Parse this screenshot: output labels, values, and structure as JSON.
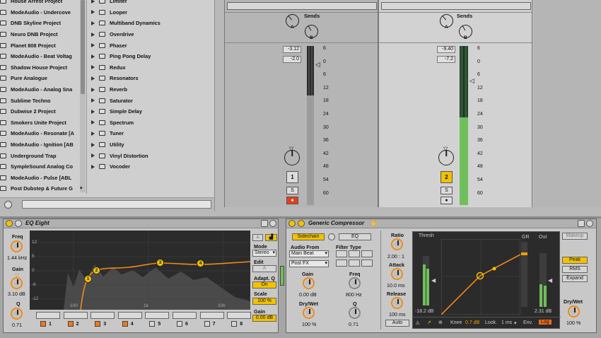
{
  "browser": {
    "left_items": [
      "House Arrest Project",
      "ModeAudio - Undercove",
      "DNB Skyline Project",
      "Neuro DNB Project",
      "Planet 808 Project",
      "ModeAudio - Beat Voltag",
      "Shadow House Project",
      "Pure Analogue",
      "ModeAudio - Analog Sna",
      "Sublime Techno",
      "Dubwise 2 Project",
      "Smokers Unite Project",
      "ModeAudio - Resonate [A",
      "ModeAudio - Ignition [AB",
      "Underground Trap",
      "SympleSound Analog Co",
      "ModeAudio - Pulse [ABL",
      "Post Dubstep & Future G"
    ],
    "right_items": [
      "Limiter",
      "Looper",
      "Multiband Dynamics",
      "Overdrive",
      "Phaser",
      "Ping Pong Delay",
      "Redux",
      "Resonators",
      "Reverb",
      "Saturator",
      "Simple Delay",
      "Spectrum",
      "Tuner",
      "Utility",
      "Vinyl Distortion",
      "Vocoder"
    ]
  },
  "mixer": {
    "strips": [
      {
        "sends_label": "Sends",
        "send_a": "A",
        "send_b": "B",
        "peak": "-3.12",
        "volume": "-2.0",
        "track_number": "1",
        "solo": "S",
        "number_active": false
      },
      {
        "sends_label": "Sends",
        "send_a": "A",
        "send_b": "B",
        "peak": "-9.40",
        "volume": "-7.2",
        "track_number": "2",
        "solo": "S",
        "number_active": true
      }
    ],
    "scale": [
      "6",
      "0",
      "6",
      "12",
      "18",
      "24",
      "30",
      "36",
      "42",
      "48",
      "54",
      "60"
    ],
    "scale_left": [
      "6",
      "0",
      "6",
      "12",
      "18",
      "24",
      "30",
      "36",
      "42",
      "48",
      "54",
      "60"
    ],
    "meter_levels": {
      "track1": 0.0,
      "track2": 0.55
    }
  },
  "eq": {
    "title": "EQ Eight",
    "freq_label": "Freq",
    "freq_value": "1.44 kHz",
    "gain_label": "Gain",
    "gain_value": "3.10 dB",
    "q_label": "Q",
    "q_value": "0.71",
    "db_ticks": [
      "12",
      "6",
      "0",
      "-6",
      "-12"
    ],
    "hz_ticks": [
      "100",
      "1k",
      "10k"
    ],
    "bands": [
      "1",
      "2",
      "3",
      "4",
      "5",
      "6",
      "7",
      "8"
    ],
    "mode_label": "Mode",
    "mode_value": "Stereo",
    "edit_label": "Edit",
    "edit_value": "A",
    "adapt_label": "Adapt. Q",
    "adapt_value": "On",
    "scale_label": "Scale",
    "scale_value": "100 %",
    "gain_out_label": "Gain",
    "gain_out_value": "0.00 dB",
    "points": [
      "1",
      "2",
      "3",
      "4"
    ]
  },
  "comp": {
    "title": "Generic Compressor",
    "sidechain": "Sidechain",
    "eq_btn": "EQ",
    "audio_from_label": "Audio From",
    "audio_from_value": "Main Beat",
    "post_fx": "Post FX",
    "filter_type_label": "Filter Type",
    "gain_label": "Gain",
    "gain_value": "0.00 dB",
    "freq_label": "Freq",
    "freq_value": "800 Hz",
    "drywet_label": "Dry/Wet",
    "drywet_value": "100 %",
    "q_label": "Q",
    "q_value": "0.71",
    "ratio_label": "Ratio",
    "ratio_value": "2.00 : 1",
    "attack_label": "Attack",
    "attack_value": "10.0 ms",
    "release_label": "Release",
    "release_value": "100 ms",
    "auto": "Auto",
    "thresh_label": "Thresh",
    "thresh_value": "-18.2 dB",
    "gr_label": "GR",
    "out_label": "Out",
    "out_value": "2.31 dB",
    "knee_label": "Knee",
    "knee_value": "0.7 dB",
    "look_label": "Look.",
    "look_value": "1 ms",
    "env_label": "Env.",
    "env_value": "Log",
    "makeup": "Makeup",
    "peak": "Peak",
    "rms": "RMS",
    "expand": "Expand",
    "drywet2_label": "Dry/Wet",
    "drywet2_value": "100 %"
  }
}
